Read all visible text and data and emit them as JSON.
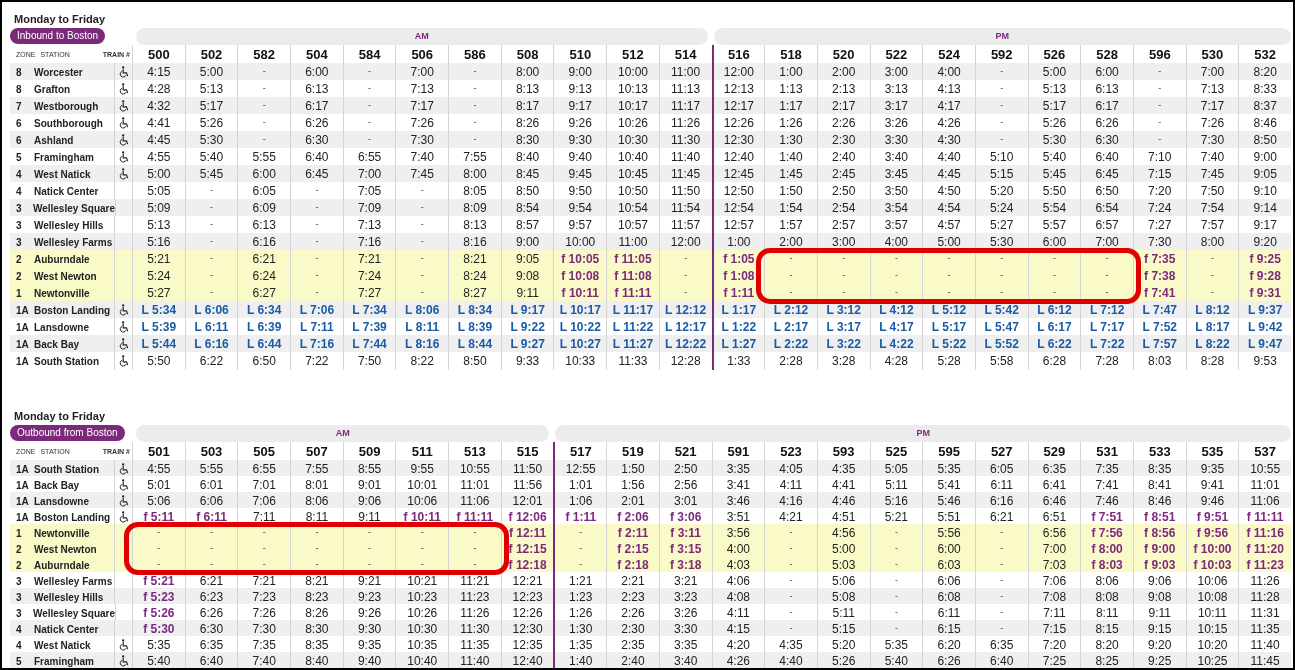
{
  "tables": [
    {
      "title": "Monday to Friday",
      "direction": "Inbound to Boston",
      "header": {
        "zone": "ZONE",
        "station": "STATION",
        "train": "TRAIN #"
      },
      "bands": [
        {
          "label": "AM",
          "trains": [
            "500",
            "502",
            "582",
            "504",
            "584",
            "506",
            "586",
            "508",
            "510",
            "512",
            "514"
          ]
        },
        {
          "label": "PM",
          "trains": [
            "516",
            "518",
            "520",
            "522",
            "524",
            "592",
            "526",
            "528",
            "596",
            "530",
            "532"
          ]
        }
      ],
      "rows": [
        {
          "zone": "8",
          "station": "Worcester",
          "accessible": true,
          "highlighted": false,
          "kind": "plain",
          "times": [
            "4:15",
            "5:00",
            "-",
            "6:00",
            "-",
            "7:00",
            "-",
            "8:00",
            "9:00",
            "10:00",
            "11:00",
            "12:00",
            "1:00",
            "2:00",
            "3:00",
            "4:00",
            "-",
            "5:00",
            "6:00",
            "-",
            "7:00",
            "8:20"
          ]
        },
        {
          "zone": "8",
          "station": "Grafton",
          "accessible": true,
          "highlighted": false,
          "kind": "plain",
          "times": [
            "4:28",
            "5:13",
            "-",
            "6:13",
            "-",
            "7:13",
            "-",
            "8:13",
            "9:13",
            "10:13",
            "11:13",
            "12:13",
            "1:13",
            "2:13",
            "3:13",
            "4:13",
            "-",
            "5:13",
            "6:13",
            "-",
            "7:13",
            "8:33"
          ]
        },
        {
          "zone": "7",
          "station": "Westborough",
          "accessible": true,
          "highlighted": false,
          "kind": "plain",
          "times": [
            "4:32",
            "5:17",
            "-",
            "6:17",
            "-",
            "7:17",
            "-",
            "8:17",
            "9:17",
            "10:17",
            "11:17",
            "12:17",
            "1:17",
            "2:17",
            "3:17",
            "4:17",
            "-",
            "5:17",
            "6:17",
            "-",
            "7:17",
            "8:37"
          ]
        },
        {
          "zone": "6",
          "station": "Southborough",
          "accessible": true,
          "highlighted": false,
          "kind": "plain",
          "times": [
            "4:41",
            "5:26",
            "-",
            "6:26",
            "-",
            "7:26",
            "-",
            "8:26",
            "9:26",
            "10:26",
            "11:26",
            "12:26",
            "1:26",
            "2:26",
            "3:26",
            "4:26",
            "-",
            "5:26",
            "6:26",
            "-",
            "7:26",
            "8:46"
          ]
        },
        {
          "zone": "6",
          "station": "Ashland",
          "accessible": true,
          "highlighted": false,
          "kind": "plain",
          "times": [
            "4:45",
            "5:30",
            "-",
            "6:30",
            "-",
            "7:30",
            "-",
            "8:30",
            "9:30",
            "10:30",
            "11:30",
            "12:30",
            "1:30",
            "2:30",
            "3:30",
            "4:30",
            "-",
            "5:30",
            "6:30",
            "-",
            "7:30",
            "8:50"
          ]
        },
        {
          "zone": "5",
          "station": "Framingham",
          "accessible": true,
          "highlighted": false,
          "kind": "plain",
          "times": [
            "4:55",
            "5:40",
            "5:55",
            "6:40",
            "6:55",
            "7:40",
            "7:55",
            "8:40",
            "9:40",
            "10:40",
            "11:40",
            "12:40",
            "1:40",
            "2:40",
            "3:40",
            "4:40",
            "5:10",
            "5:40",
            "6:40",
            "7:10",
            "7:40",
            "9:00"
          ]
        },
        {
          "zone": "4",
          "station": "West Natick",
          "accessible": true,
          "highlighted": false,
          "kind": "plain",
          "times": [
            "5:00",
            "5:45",
            "6:00",
            "6:45",
            "7:00",
            "7:45",
            "8:00",
            "8:45",
            "9:45",
            "10:45",
            "11:45",
            "12:45",
            "1:45",
            "2:45",
            "3:45",
            "4:45",
            "5:15",
            "5:45",
            "6:45",
            "7:15",
            "7:45",
            "9:05"
          ]
        },
        {
          "zone": "4",
          "station": "Natick Center",
          "accessible": false,
          "highlighted": false,
          "kind": "plain",
          "times": [
            "5:05",
            "-",
            "6:05",
            "-",
            "7:05",
            "-",
            "8:05",
            "8:50",
            "9:50",
            "10:50",
            "11:50",
            "12:50",
            "1:50",
            "2:50",
            "3:50",
            "4:50",
            "5:20",
            "5:50",
            "6:50",
            "7:20",
            "7:50",
            "9:10"
          ]
        },
        {
          "zone": "3",
          "station": "Wellesley Square",
          "accessible": false,
          "highlighted": false,
          "kind": "plain",
          "times": [
            "5:09",
            "-",
            "6:09",
            "-",
            "7:09",
            "-",
            "8:09",
            "8:54",
            "9:54",
            "10:54",
            "11:54",
            "12:54",
            "1:54",
            "2:54",
            "3:54",
            "4:54",
            "5:24",
            "5:54",
            "6:54",
            "7:24",
            "7:54",
            "9:14"
          ]
        },
        {
          "zone": "3",
          "station": "Wellesley Hills",
          "accessible": false,
          "highlighted": false,
          "kind": "plain",
          "times": [
            "5:13",
            "-",
            "6:13",
            "-",
            "7:13",
            "-",
            "8:13",
            "8:57",
            "9:57",
            "10:57",
            "11:57",
            "12:57",
            "1:57",
            "2:57",
            "3:57",
            "4:57",
            "5:27",
            "5:57",
            "6:57",
            "7:27",
            "7:57",
            "9:17"
          ]
        },
        {
          "zone": "3",
          "station": "Wellesley Farms",
          "accessible": false,
          "highlighted": false,
          "kind": "plain",
          "times": [
            "5:16",
            "-",
            "6:16",
            "-",
            "7:16",
            "-",
            "8:16",
            "9:00",
            "10:00",
            "11:00",
            "12:00",
            "1:00",
            "2:00",
            "3:00",
            "4:00",
            "5:00",
            "5:30",
            "6:00",
            "7:00",
            "7:30",
            "8:00",
            "9:20"
          ]
        },
        {
          "zone": "2",
          "station": "Auburndale",
          "accessible": false,
          "highlighted": true,
          "kind": "plain",
          "times": [
            "5:21",
            "-",
            "6:21",
            "-",
            "7:21",
            "-",
            "8:21",
            "9:05",
            {
              "text": "f 10:05",
              "kind": "flag"
            },
            {
              "text": "f 11:05",
              "kind": "flag"
            },
            "-",
            {
              "text": "f 1:05",
              "kind": "flag"
            },
            "-",
            "-",
            "-",
            "-",
            "-",
            "-",
            "-",
            {
              "text": "f 7:35",
              "kind": "flag"
            },
            "-",
            {
              "text": "f 9:25",
              "kind": "flag"
            }
          ]
        },
        {
          "zone": "2",
          "station": "West Newton",
          "accessible": false,
          "highlighted": true,
          "kind": "plain",
          "times": [
            "5:24",
            "-",
            "6:24",
            "-",
            "7:24",
            "-",
            "8:24",
            "9:08",
            {
              "text": "f 10:08",
              "kind": "flag"
            },
            {
              "text": "f 11:08",
              "kind": "flag"
            },
            "-",
            {
              "text": "f 1:08",
              "kind": "flag"
            },
            "-",
            "-",
            "-",
            "-",
            "-",
            "-",
            "-",
            {
              "text": "f 7:38",
              "kind": "flag"
            },
            "-",
            {
              "text": "f 9:28",
              "kind": "flag"
            }
          ]
        },
        {
          "zone": "1",
          "station": "Newtonville",
          "accessible": false,
          "highlighted": true,
          "kind": "plain",
          "times": [
            "5:27",
            "-",
            "6:27",
            "-",
            "7:27",
            "-",
            "8:27",
            "9:11",
            {
              "text": "f 10:11",
              "kind": "flag"
            },
            {
              "text": "f 11:11",
              "kind": "flag"
            },
            "-",
            {
              "text": "f 1:11",
              "kind": "flag"
            },
            "-",
            "-",
            "-",
            "-",
            "-",
            "-",
            "-",
            {
              "text": "f 7:41",
              "kind": "flag"
            },
            "-",
            {
              "text": "f 9:31",
              "kind": "flag"
            }
          ]
        },
        {
          "zone": "1A",
          "station": "Boston Landing",
          "accessible": true,
          "highlighted": false,
          "kind": "late",
          "times": [
            "L 5:34",
            "L 6:06",
            "L 6:34",
            "L 7:06",
            "L 7:34",
            "L 8:06",
            "L 8:34",
            "L 9:17",
            "L 10:17",
            "L 11:17",
            "L 12:12",
            "L 1:17",
            "L 2:12",
            "L 3:12",
            "L 4:12",
            "L 5:12",
            "L 5:42",
            "L 6:12",
            "L 7:12",
            "L 7:47",
            "L 8:12",
            "L 9:37"
          ]
        },
        {
          "zone": "1A",
          "station": "Lansdowne",
          "accessible": true,
          "highlighted": false,
          "kind": "late",
          "times": [
            "L 5:39",
            "L 6:11",
            "L 6:39",
            "L 7:11",
            "L 7:39",
            "L 8:11",
            "L 8:39",
            "L 9:22",
            "L 10:22",
            "L 11:22",
            "L 12:17",
            "L 1:22",
            "L 2:17",
            "L 3:17",
            "L 4:17",
            "L 5:17",
            "L 5:47",
            "L 6:17",
            "L 7:17",
            "L 7:52",
            "L 8:17",
            "L 9:42"
          ]
        },
        {
          "zone": "1A",
          "station": "Back Bay",
          "accessible": true,
          "highlighted": false,
          "kind": "late",
          "times": [
            "L 5:44",
            "L 6:16",
            "L 6:44",
            "L 7:16",
            "L 7:44",
            "L 8:16",
            "L 8:44",
            "L 9:27",
            "L 10:27",
            "L 11:27",
            "L 12:22",
            "L 1:27",
            "L 2:22",
            "L 3:22",
            "L 4:22",
            "L 5:22",
            "L 5:52",
            "L 6:22",
            "L 7:22",
            "L 7:57",
            "L 8:22",
            "L 9:47"
          ]
        },
        {
          "zone": "1A",
          "station": "South Station",
          "accessible": true,
          "highlighted": false,
          "kind": "plain",
          "times": [
            "5:50",
            "6:22",
            "6:50",
            "7:22",
            "7:50",
            "8:22",
            "8:50",
            "9:33",
            "10:33",
            "11:33",
            "12:28",
            "1:33",
            "2:28",
            "3:28",
            "4:28",
            "5:28",
            "5:58",
            "6:28",
            "7:28",
            "8:03",
            "8:28",
            "9:53"
          ]
        }
      ]
    },
    {
      "title": "Monday to Friday",
      "direction": "Outbound from Boston",
      "header": {
        "zone": "ZONE",
        "station": "STATION",
        "train": "TRAIN #"
      },
      "bands": [
        {
          "label": "AM",
          "trains": [
            "501",
            "503",
            "505",
            "507",
            "509",
            "511",
            "513",
            "515"
          ]
        },
        {
          "label": "PM",
          "trains": [
            "517",
            "519",
            "521",
            "591",
            "523",
            "593",
            "525",
            "595",
            "527",
            "529",
            "531",
            "533",
            "535",
            "537"
          ]
        }
      ],
      "rows": [
        {
          "zone": "1A",
          "station": "South Station",
          "accessible": true,
          "highlighted": false,
          "kind": "plain",
          "times": [
            "4:55",
            "5:55",
            "6:55",
            "7:55",
            "8:55",
            "9:55",
            "10:55",
            "11:50",
            "12:55",
            "1:50",
            "2:50",
            "3:35",
            "4:05",
            "4:35",
            "5:05",
            "5:35",
            "6:05",
            "6:35",
            "7:35",
            "8:35",
            "9:35",
            "10:55"
          ]
        },
        {
          "zone": "1A",
          "station": "Back Bay",
          "accessible": true,
          "highlighted": false,
          "kind": "plain",
          "times": [
            "5:01",
            "6:01",
            "7:01",
            "8:01",
            "9:01",
            "10:01",
            "11:01",
            "11:56",
            "1:01",
            "1:56",
            "2:56",
            "3:41",
            "4:11",
            "4:41",
            "5:11",
            "5:41",
            "6:11",
            "6:41",
            "7:41",
            "8:41",
            "9:41",
            "11:01"
          ]
        },
        {
          "zone": "1A",
          "station": "Lansdowne",
          "accessible": true,
          "highlighted": false,
          "kind": "plain",
          "times": [
            "5:06",
            "6:06",
            "7:06",
            "8:06",
            "9:06",
            "10:06",
            "11:06",
            "12:01",
            "1:06",
            "2:01",
            "3:01",
            "3:46",
            "4:16",
            "4:46",
            "5:16",
            "5:46",
            "6:16",
            "6:46",
            "7:46",
            "8:46",
            "9:46",
            "11:06"
          ]
        },
        {
          "zone": "1A",
          "station": "Boston Landing",
          "accessible": true,
          "highlighted": false,
          "kind": "plain",
          "times": [
            {
              "text": "f 5:11",
              "kind": "flag"
            },
            {
              "text": "f 6:11",
              "kind": "flag"
            },
            "7:11",
            "8:11",
            "9:11",
            {
              "text": "f 10:11",
              "kind": "flag"
            },
            {
              "text": "f 11:11",
              "kind": "flag"
            },
            {
              "text": "f 12:06",
              "kind": "flag"
            },
            {
              "text": "f 1:11",
              "kind": "flag"
            },
            {
              "text": "f 2:06",
              "kind": "flag"
            },
            {
              "text": "f 3:06",
              "kind": "flag"
            },
            "3:51",
            "4:21",
            "4:51",
            "5:21",
            "5:51",
            "6:21",
            "6:51",
            {
              "text": "f 7:51",
              "kind": "flag"
            },
            {
              "text": "f 8:51",
              "kind": "flag"
            },
            {
              "text": "f 9:51",
              "kind": "flag"
            },
            {
              "text": "f 11:11",
              "kind": "flag"
            }
          ]
        },
        {
          "zone": "1",
          "station": "Newtonville",
          "accessible": false,
          "highlighted": true,
          "kind": "plain",
          "times": [
            "-",
            "-",
            "-",
            "-",
            "-",
            "-",
            "-",
            {
              "text": "f 12:11",
              "kind": "flag"
            },
            "-",
            {
              "text": "f 2:11",
              "kind": "flag"
            },
            {
              "text": "f 3:11",
              "kind": "flag"
            },
            "3:56",
            "-",
            "4:56",
            "-",
            "5:56",
            "-",
            "6:56",
            {
              "text": "f 7:56",
              "kind": "flag"
            },
            {
              "text": "f 8:56",
              "kind": "flag"
            },
            {
              "text": "f 9:56",
              "kind": "flag"
            },
            {
              "text": "f 11:16",
              "kind": "flag"
            }
          ]
        },
        {
          "zone": "2",
          "station": "West Newton",
          "accessible": false,
          "highlighted": true,
          "kind": "plain",
          "times": [
            "-",
            "-",
            "-",
            "-",
            "-",
            "-",
            "-",
            {
              "text": "f 12:15",
              "kind": "flag"
            },
            "-",
            {
              "text": "f 2:15",
              "kind": "flag"
            },
            {
              "text": "f 3:15",
              "kind": "flag"
            },
            "4:00",
            "-",
            "5:00",
            "-",
            "6:00",
            "-",
            "7:00",
            {
              "text": "f 8:00",
              "kind": "flag"
            },
            {
              "text": "f 9:00",
              "kind": "flag"
            },
            {
              "text": "f 10:00",
              "kind": "flag"
            },
            {
              "text": "f 11:20",
              "kind": "flag"
            }
          ]
        },
        {
          "zone": "2",
          "station": "Auburndale",
          "accessible": false,
          "highlighted": true,
          "kind": "plain",
          "times": [
            "-",
            "-",
            "-",
            "-",
            "-",
            "-",
            "-",
            {
              "text": "f 12:18",
              "kind": "flag"
            },
            "-",
            {
              "text": "f 2:18",
              "kind": "flag"
            },
            {
              "text": "f 3:18",
              "kind": "flag"
            },
            "4:03",
            "-",
            "5:03",
            "-",
            "6:03",
            "-",
            "7:03",
            {
              "text": "f 8:03",
              "kind": "flag"
            },
            {
              "text": "f 9:03",
              "kind": "flag"
            },
            {
              "text": "f 10:03",
              "kind": "flag"
            },
            {
              "text": "f 11:23",
              "kind": "flag"
            }
          ]
        },
        {
          "zone": "3",
          "station": "Wellesley Farms",
          "accessible": false,
          "highlighted": false,
          "kind": "plain",
          "times": [
            {
              "text": "f 5:21",
              "kind": "flag"
            },
            "6:21",
            "7:21",
            "8:21",
            "9:21",
            "10:21",
            "11:21",
            "12:21",
            "1:21",
            "2:21",
            "3:21",
            "4:06",
            "-",
            "5:06",
            "-",
            "6:06",
            "-",
            "7:06",
            "8:06",
            "9:06",
            "10:06",
            "11:26"
          ]
        },
        {
          "zone": "3",
          "station": "Wellesley Hills",
          "accessible": false,
          "highlighted": false,
          "kind": "plain",
          "times": [
            {
              "text": "f 5:23",
              "kind": "flag"
            },
            "6:23",
            "7:23",
            "8:23",
            "9:23",
            "10:23",
            "11:23",
            "12:23",
            "1:23",
            "2:23",
            "3:23",
            "4:08",
            "-",
            "5:08",
            "-",
            "6:08",
            "-",
            "7:08",
            "8:08",
            "9:08",
            "10:08",
            "11:28"
          ]
        },
        {
          "zone": "3",
          "station": "Wellesley Square",
          "accessible": false,
          "highlighted": false,
          "kind": "plain",
          "times": [
            {
              "text": "f 5:26",
              "kind": "flag"
            },
            "6:26",
            "7:26",
            "8:26",
            "9:26",
            "10:26",
            "11:26",
            "12:26",
            "1:26",
            "2:26",
            "3:26",
            "4:11",
            "-",
            "5:11",
            "-",
            "6:11",
            "-",
            "7:11",
            "8:11",
            "9:11",
            "10:11",
            "11:31"
          ]
        },
        {
          "zone": "4",
          "station": "Natick Center",
          "accessible": false,
          "highlighted": false,
          "kind": "plain",
          "times": [
            {
              "text": "f 5:30",
              "kind": "flag"
            },
            "6:30",
            "7:30",
            "8:30",
            "9:30",
            "10:30",
            "11:30",
            "12:30",
            "1:30",
            "2:30",
            "3:30",
            "4:15",
            "-",
            "5:15",
            "-",
            "6:15",
            "-",
            "7:15",
            "8:15",
            "9:15",
            "10:15",
            "11:35"
          ]
        },
        {
          "zone": "4",
          "station": "West Natick",
          "accessible": true,
          "highlighted": false,
          "kind": "plain",
          "times": [
            "5:35",
            "6:35",
            "7:35",
            "8:35",
            "9:35",
            "10:35",
            "11:35",
            "12:35",
            "1:35",
            "2:35",
            "3:35",
            "4:20",
            "4:35",
            "5:20",
            "5:35",
            "6:20",
            "6:35",
            "7:20",
            "8:20",
            "9:20",
            "10:20",
            "11:40"
          ]
        },
        {
          "zone": "5",
          "station": "Framingham",
          "accessible": true,
          "highlighted": false,
          "kind": "plain",
          "times": [
            "5:40",
            "6:40",
            "7:40",
            "8:40",
            "9:40",
            "10:40",
            "11:40",
            "12:40",
            "1:40",
            "2:40",
            "3:40",
            "4:26",
            "4:40",
            "5:26",
            "5:40",
            "6:26",
            "6:40",
            "7:25",
            "8:25",
            "9:25",
            "10:25",
            "11:45"
          ]
        }
      ]
    }
  ]
}
